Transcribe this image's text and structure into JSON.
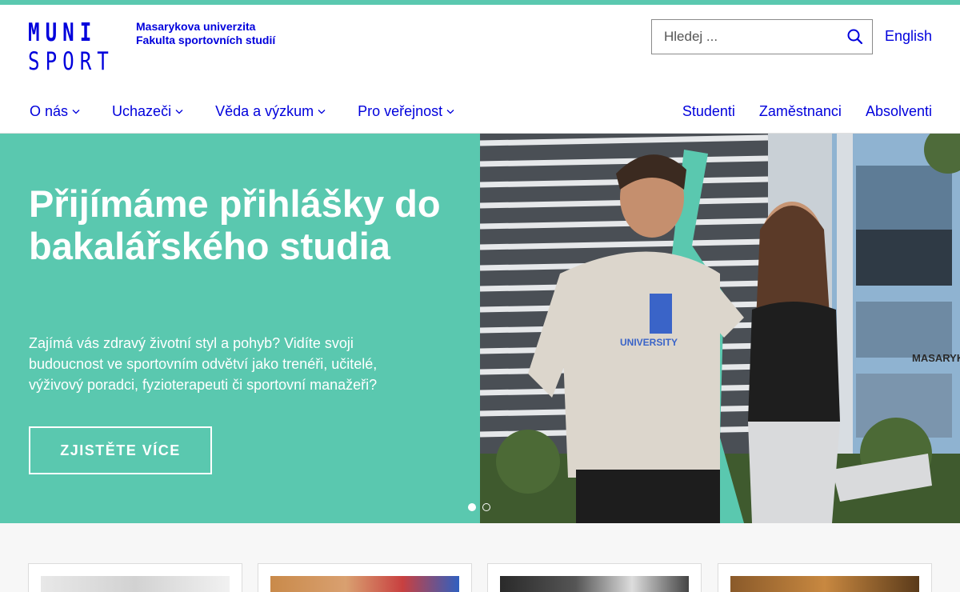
{
  "header": {
    "logo_line1": "MUNI",
    "logo_line2": "SPORT",
    "university": "Masarykova univerzita",
    "faculty": "Fakulta sportovních studií",
    "search_placeholder": "Hledej ...",
    "language": "English"
  },
  "nav": {
    "main": [
      {
        "label": "O nás"
      },
      {
        "label": "Uchazeči"
      },
      {
        "label": "Věda a výzkum"
      },
      {
        "label": "Pro veřejnost"
      }
    ],
    "secondary": [
      {
        "label": "Studenti"
      },
      {
        "label": "Zaměstnanci"
      },
      {
        "label": "Absolventi"
      }
    ]
  },
  "hero": {
    "title": "Přijímáme přihlášky do bakalářského studia",
    "text": "Zajímá vás zdravý životní styl a pohyb? Vidíte svoji budoucnost ve sportovním odvětví jako trenéři, učitelé, výživový poradci, fyzioterapeuti či sportovní manažeři?",
    "button": "ZJISTĚTE VÍCE",
    "slides_total": 2,
    "slide_active": 1
  },
  "colors": {
    "brand_blue": "#0000dc",
    "accent_green": "#5ac8af"
  }
}
